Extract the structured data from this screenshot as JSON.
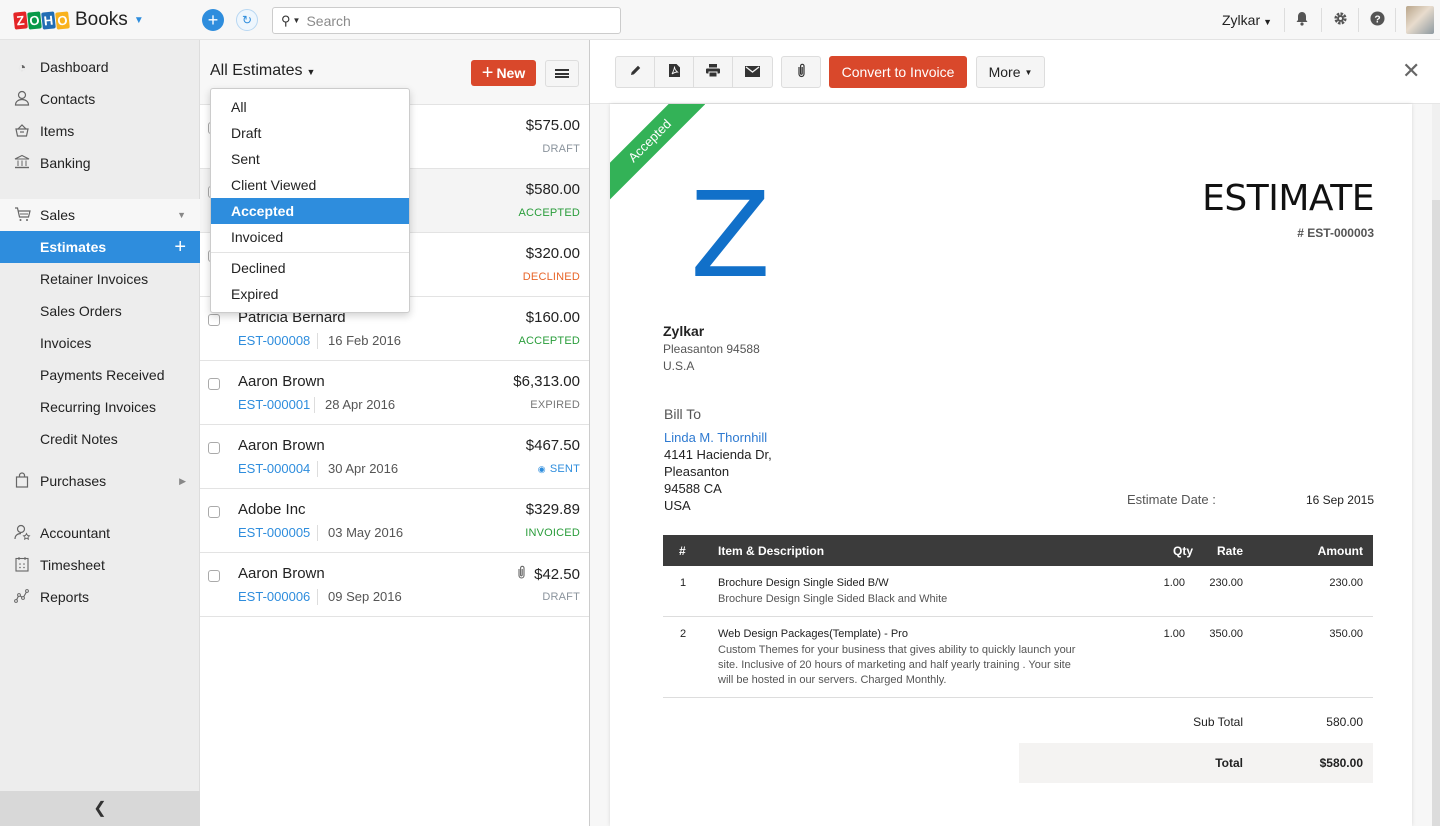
{
  "topbar": {
    "logo_letters": [
      "Z",
      "O",
      "H",
      "O"
    ],
    "logo_colors": [
      "#e42527",
      "#089949",
      "#226db4",
      "#f9b21d"
    ],
    "app_name": "Books",
    "search_placeholder": "Search",
    "org_name": "Zylkar",
    "icons": [
      "bell-icon",
      "gear-icon",
      "help-icon"
    ]
  },
  "sidebar": {
    "items": [
      {
        "label": "Dashboard",
        "icon": "dashboard-icon"
      },
      {
        "label": "Contacts",
        "icon": "contacts-icon"
      },
      {
        "label": "Items",
        "icon": "items-icon"
      },
      {
        "label": "Banking",
        "icon": "bank-icon"
      },
      {
        "label": "Sales",
        "icon": "cart-icon"
      },
      {
        "label": "Estimates"
      },
      {
        "label": "Retainer Invoices"
      },
      {
        "label": "Sales Orders"
      },
      {
        "label": "Invoices"
      },
      {
        "label": "Payments Received"
      },
      {
        "label": "Recurring Invoices"
      },
      {
        "label": "Credit Notes"
      },
      {
        "label": "Purchases",
        "icon": "bag-icon"
      },
      {
        "label": "Accountant",
        "icon": "accountant-icon"
      },
      {
        "label": "Timesheet",
        "icon": "timesheet-icon"
      },
      {
        "label": "Reports",
        "icon": "reports-icon"
      }
    ],
    "active": "Estimates",
    "accent": "#2e8ddd"
  },
  "list": {
    "title": "All Estimates",
    "new_label": "New",
    "filter_options": [
      "All",
      "Draft",
      "Sent",
      "Client Viewed",
      "Accepted",
      "Invoiced",
      "Declined",
      "Expired"
    ],
    "filter_highlighted": "Accepted",
    "rows": [
      {
        "customer": "",
        "number": "",
        "date": "",
        "amount": "$575.00",
        "status": "DRAFT",
        "status_color": "#8a939c"
      },
      {
        "customer": "",
        "number": "",
        "date": "",
        "amount": "$580.00",
        "status": "ACCEPTED",
        "status_color": "#2a9d3b"
      },
      {
        "customer": "",
        "number": "",
        "date": "",
        "amount": "$320.00",
        "status": "DECLINED",
        "status_color": "#e8662a"
      },
      {
        "customer": "Patricia Bernard",
        "number": "EST-000008",
        "date": "16 Feb 2016",
        "amount": "$160.00",
        "status": "ACCEPTED",
        "status_color": "#2a9d3b"
      },
      {
        "customer": "Aaron Brown",
        "number": "EST-000001",
        "date": "28 Apr 2016",
        "amount": "$6,313.00",
        "status": "EXPIRED",
        "status_color": "#777777"
      },
      {
        "customer": "Aaron Brown",
        "number": "EST-000004",
        "date": "30 Apr 2016",
        "amount": "$467.50",
        "status": "SENT",
        "status_color": "#2e8ddd",
        "status_icon": "eye-icon"
      },
      {
        "customer": "Adobe Inc",
        "number": "EST-000005",
        "date": "03 May 2016",
        "amount": "$329.89",
        "status": "INVOICED",
        "status_color": "#2a9d3b"
      },
      {
        "customer": "Aaron Brown",
        "number": "EST-000006",
        "date": "09 Sep 2016",
        "amount": "$42.50",
        "status": "DRAFT",
        "status_color": "#8a939c",
        "attachment": true
      }
    ]
  },
  "detail": {
    "toolbar": {
      "icons": [
        "edit-icon",
        "pdf-icon",
        "print-icon",
        "email-icon"
      ],
      "attach_icon": "attachment-icon",
      "convert_label": "Convert to Invoice",
      "more_label": "More"
    },
    "ribbon": "Accepted",
    "logo_letter": "Z",
    "doc_title": "ESTIMATE",
    "doc_number": "# EST-000003",
    "org": {
      "name": "Zylkar",
      "lines": [
        "Pleasanton  94588",
        "U.S.A"
      ]
    },
    "bill_to": {
      "label": "Bill To",
      "name": "Linda M. Thornhill",
      "lines": [
        "4141 Hacienda Dr,",
        "Pleasanton",
        "94588 CA",
        "USA"
      ]
    },
    "estimate_date_label": "Estimate Date :",
    "estimate_date": "16 Sep 2015",
    "table": {
      "headers": [
        "#",
        "Item & Description",
        "Qty",
        "Rate",
        "Amount"
      ],
      "rows": [
        {
          "n": "1",
          "item": "Brochure Design Single Sided B/W",
          "desc": "Brochure Design Single Sided Black and White",
          "qty": "1.00",
          "rate": "230.00",
          "amount": "230.00"
        },
        {
          "n": "2",
          "item": "Web Design Packages(Template) - Pro",
          "desc": "Custom Themes for your business that gives ability to quickly launch your site. Inclusive of 20 hours of marketing and half yearly training . Your site will be hosted in our servers.  Charged Monthly.",
          "qty": "1.00",
          "rate": "350.00",
          "amount": "350.00"
        }
      ]
    },
    "sub_total_label": "Sub Total",
    "sub_total": "580.00",
    "total_label": "Total",
    "total": "$580.00"
  }
}
